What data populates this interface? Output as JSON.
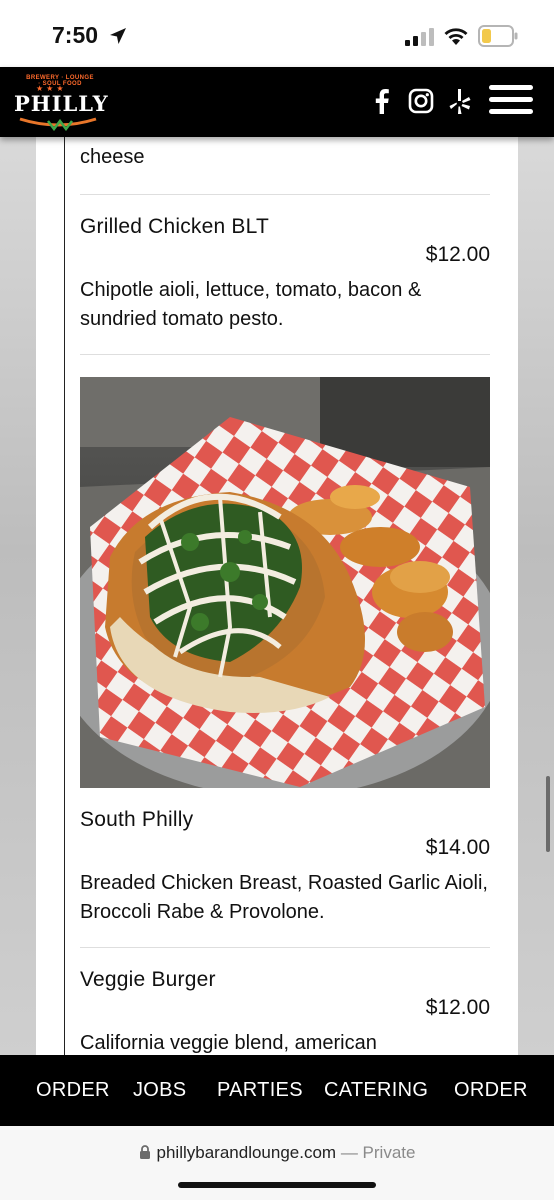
{
  "status_bar": {
    "time": "7:50"
  },
  "header": {
    "logo": {
      "tagline": "BREWERY · LOUNGE · SOUL FOOD",
      "name": "PHILLY"
    }
  },
  "menu": {
    "partial_top_text": "cheese",
    "items": [
      {
        "title": "Grilled Chicken BLT",
        "price": "$12.00",
        "description": "Chipotle aioli, lettuce, tomato, bacon & sundried tomato pesto."
      },
      {
        "title": "South Philly",
        "price": "$14.00",
        "description": "Breaded Chicken Breast, Roasted Garlic Aioli, Broccoli Rabe & Provolone."
      },
      {
        "title": "Veggie Burger",
        "price": "$12.00",
        "description": "California veggie blend, american"
      }
    ]
  },
  "bottom_nav": {
    "items": [
      "ORDER",
      "JOBS",
      "PARTIES",
      "CATERING",
      "ORDER"
    ]
  },
  "browser": {
    "url": "phillybarandlounge.com",
    "separator": "—",
    "privacy": "Private"
  }
}
